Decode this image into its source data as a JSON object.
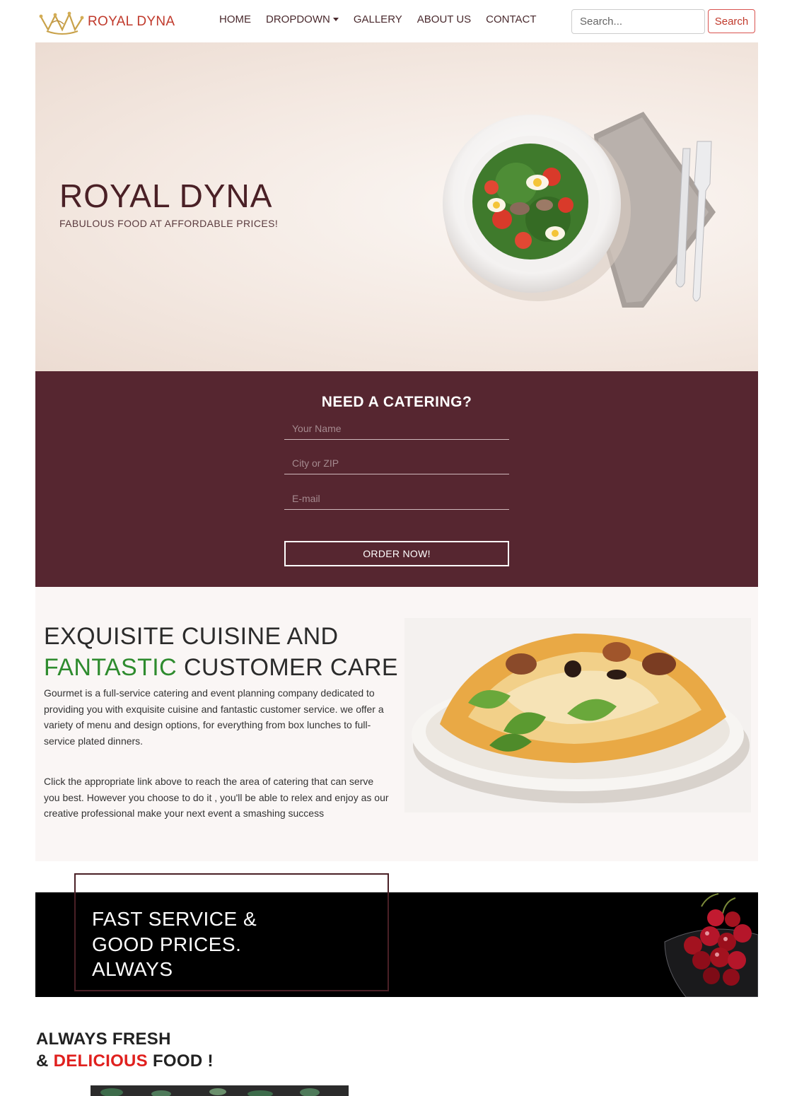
{
  "navbar": {
    "brand": "ROYAL DYNA",
    "items": [
      {
        "label": "HOME"
      },
      {
        "label": "DROPDOWN",
        "has_caret": true
      },
      {
        "label": "GALLERY"
      },
      {
        "label": "ABOUT US"
      },
      {
        "label": "CONTACT"
      }
    ],
    "search_placeholder": "Search...",
    "search_button": "Search"
  },
  "hero": {
    "title": "ROYAL DYNA",
    "subtitle": "FABULOUS FOOD AT AFFORDABLE PRICES!"
  },
  "catering": {
    "title": "NEED A CATERING?",
    "name_placeholder": "Your Name",
    "city_placeholder": "City or ZIP",
    "email_placeholder": "E-mail",
    "button": "ORDER NOW!"
  },
  "about": {
    "heading_line1": "EXQUISITE CUISINE AND",
    "heading_highlight": "FANTASTIC",
    "heading_line2_rest": " CUSTOMER CARE",
    "paragraph1": "Gourmet is a full-service catering and event planning company dedicated to providing you with exquisite cuisine and fantastic customer service. we offer a variety of menu and design options, for everything from box lunches to full-service plated dinners.",
    "paragraph2": "Click the appropriate link above to reach the area of catering that can serve you best. However you choose to do it , you'll be able to relex and enjoy as our creative professional make your next event a smashing success"
  },
  "promo": {
    "lines": [
      "FAST SERVICE &",
      "GOOD PRICES.",
      "ALWAYS"
    ]
  },
  "fresh": {
    "line1": "ALWAYS FRESH",
    "line2_prefix": "& ",
    "line2_highlight": "DELICIOUS",
    "line2_suffix": " FOOD !"
  },
  "colors": {
    "brand": "#c0392b",
    "catering_bg": "#562630",
    "highlight_green": "#2e8b2e",
    "highlight_red": "#e0201e"
  }
}
